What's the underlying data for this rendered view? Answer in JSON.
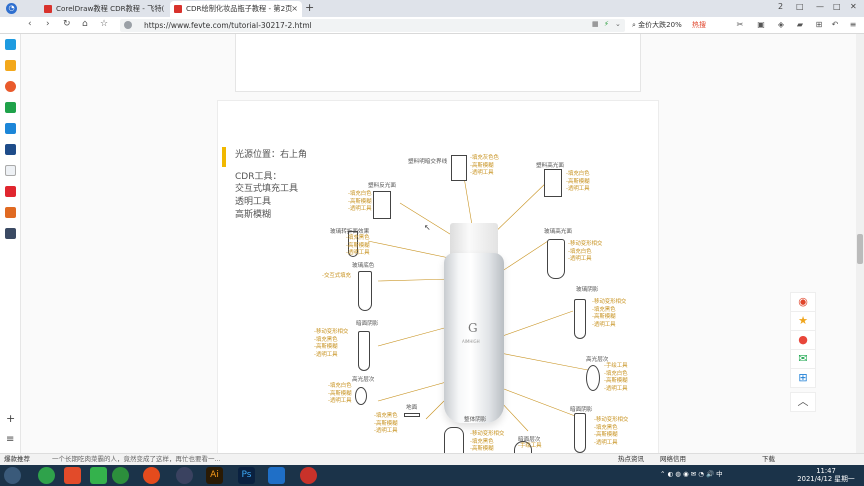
{
  "browser": {
    "tabs": [
      {
        "title": "CorelDraw教程 CDR教程 - 飞特(",
        "active": false
      },
      {
        "title": "CDR绘制化妆品瓶子教程 - 第2页",
        "active": true
      }
    ],
    "window_controls": [
      "2",
      "□",
      "—",
      "□",
      "✕"
    ],
    "url": "https://www.fevte.com/tutorial-30217-2.html",
    "search_text": "金价大跌20%",
    "search_hot": "热搜"
  },
  "article": {
    "light_position": "光源位置：右上角",
    "cdr_tools_title": "CDR工具：",
    "cdr_tools": [
      "交互式填充工具",
      "透明工具",
      "高斯模糊"
    ],
    "bottle_brand": "G",
    "bottle_sub": "AIMHIGH",
    "callouts": [
      {
        "name": "plastic-seam",
        "label": "塑料明暗交界线",
        "items": [
          "-填充灰色色",
          "-高斯模糊",
          "-透明工具"
        ]
      },
      {
        "name": "plastic-highlight",
        "label": "塑料高光面",
        "items": [
          "-填充白色",
          "-高斯模糊",
          "-透明工具"
        ]
      },
      {
        "name": "plastic-reflect",
        "label": "塑料反光面",
        "items": [
          "-填充白色",
          "-高斯模糊",
          "-透明工具"
        ]
      },
      {
        "name": "glass-refraction",
        "label": "玻璃转折面效果",
        "items": [
          "-填充黑色",
          "-高斯模糊",
          "-透明工具"
        ]
      },
      {
        "name": "glass-highlight",
        "label": "玻璃高光面",
        "items": [
          "-移动变形相交",
          "-填充白色",
          "-透明工具"
        ]
      },
      {
        "name": "glass-base",
        "label": "玻璃底色",
        "items": [
          "-交互式填充"
        ]
      },
      {
        "name": "glass-shadow",
        "label": "玻璃阴影",
        "items": [
          "-移动变形相交",
          "-填充黑色",
          "-高斯模糊",
          "-透明工具"
        ]
      },
      {
        "name": "dark-shadow",
        "label": "暗面阴影",
        "items": [
          "-移动变形相交",
          "-填充黑色",
          "-高斯模糊",
          "-透明工具"
        ]
      },
      {
        "name": "highlight-layer",
        "label": "高光层次",
        "items": [
          "-手绘工具",
          "-填充白色",
          "-高斯模糊",
          "-透明工具"
        ]
      },
      {
        "name": "highlight-level",
        "label": "高光层次",
        "items": [
          "-填充白色",
          "-高斯模糊",
          "-透明工具"
        ]
      },
      {
        "name": "floor",
        "label": "地面",
        "items": [
          "-填充黑色",
          "-高斯模糊",
          "-透明工具"
        ]
      },
      {
        "name": "overall-shadow",
        "label": "整体阴影",
        "items": [
          "-移动变形相交",
          "-填充黑色",
          "-高斯模糊"
        ]
      },
      {
        "name": "dark-level",
        "label": "暗面层次",
        "items": [
          "-手绘工具"
        ]
      },
      {
        "name": "dark-face",
        "label": "暗面阴影",
        "items": [
          "-移动变形相交",
          "-填充黑色",
          "-高斯模糊",
          "-透明工具"
        ]
      }
    ]
  },
  "statusbar": {
    "left": "爆款推荐",
    "news": "一个长期吃肉菜霸的人，竟然变成了这样，再忙也要看一...",
    "hot_news": "热点资讯",
    "network": "网络信用",
    "download": "下载"
  },
  "taskbar": {
    "time": "11:47",
    "date": "2021/4/12 星期一"
  }
}
